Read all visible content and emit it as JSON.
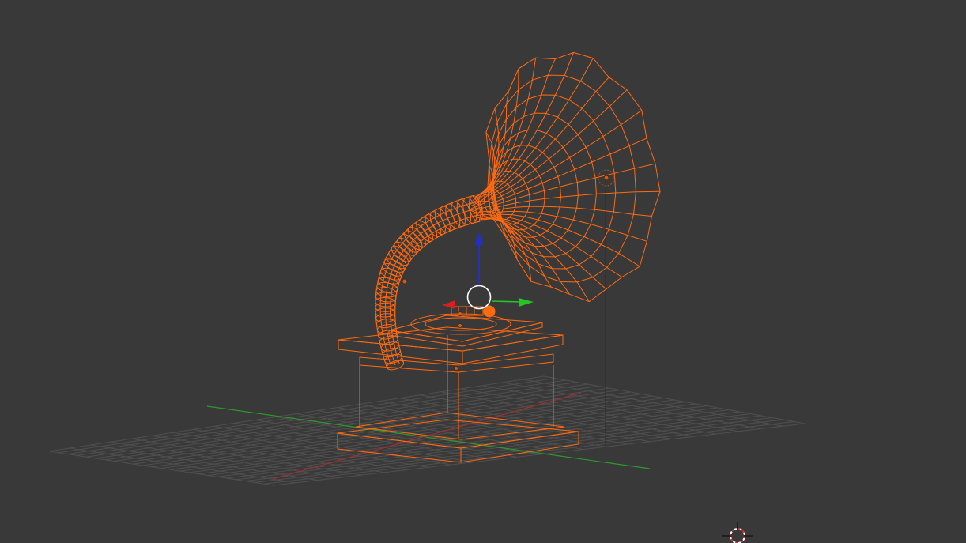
{
  "viewport": {
    "mode": "wireframe",
    "background": "#393939"
  },
  "scene": {
    "object": "gramophone",
    "selection_color": "#ff6a10",
    "floor_grid": {
      "visible": true,
      "color": "#4f4f4f"
    },
    "axes": {
      "x_color": "#c03030",
      "y_color": "#2ea82e"
    }
  },
  "manipulator": {
    "z_arrow_color": "#1f2fd8",
    "y_arrow_color": "#24c524",
    "x_arrow_color": "#d81f1f",
    "center_ring_color": "#ffffff"
  },
  "icons": {
    "cursor": "3d-cursor-icon",
    "lamp": "lamp-icon",
    "gizmo": "transform-manipulator-icon"
  }
}
